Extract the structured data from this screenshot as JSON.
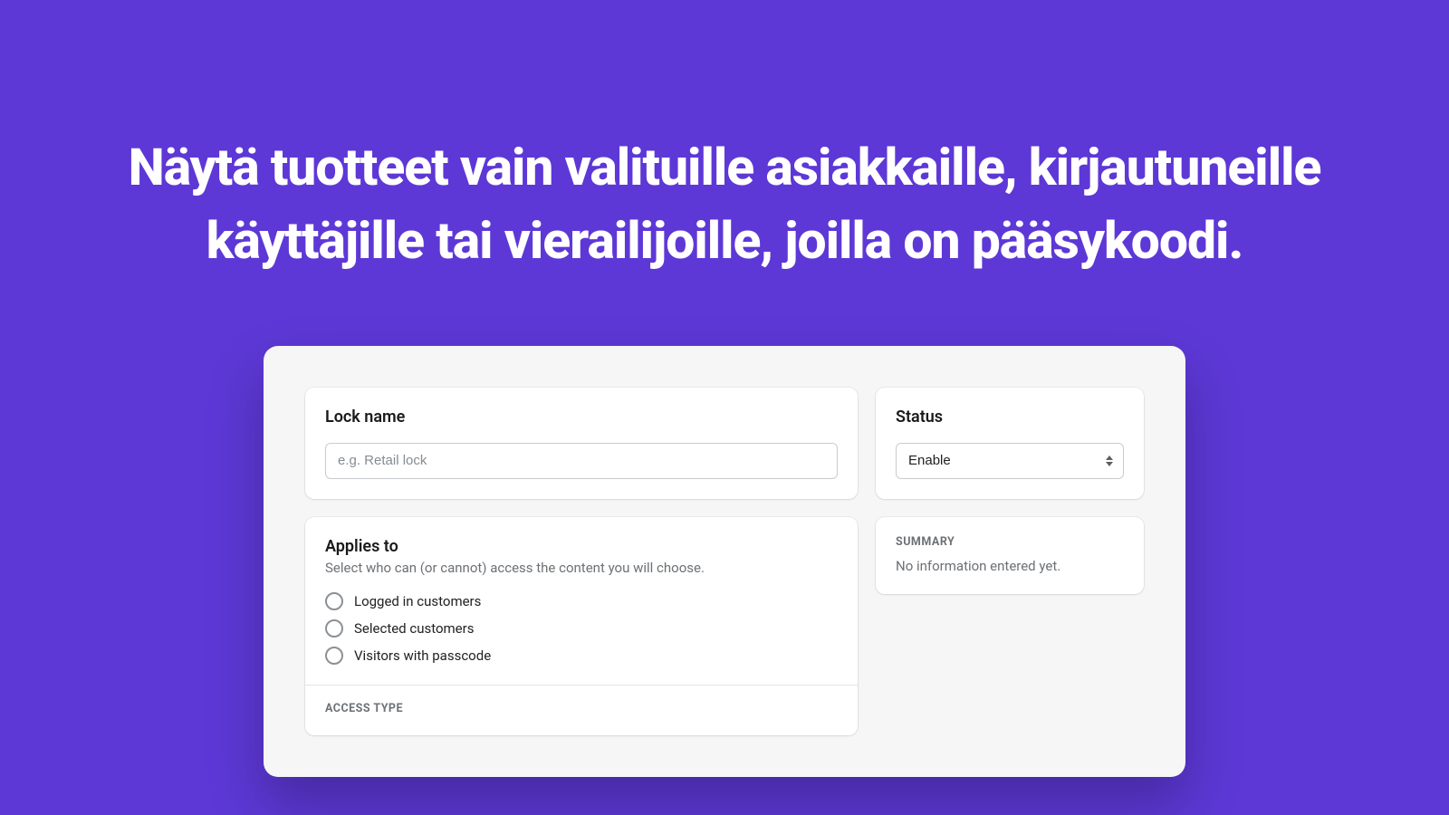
{
  "hero": {
    "headline": "Näytä tuotteet vain valituille asiakkaille, kirjautuneille käyttäjille tai vierailijoille, joilla on pääsykoodi."
  },
  "lock_name": {
    "title": "Lock name",
    "placeholder": "e.g. Retail lock",
    "value": ""
  },
  "applies_to": {
    "title": "Applies to",
    "description": "Select who can (or cannot) access the content you will choose.",
    "options": [
      "Logged in customers",
      "Selected customers",
      "Visitors with passcode"
    ]
  },
  "access_type": {
    "heading": "ACCESS TYPE"
  },
  "status": {
    "title": "Status",
    "selected": "Enable"
  },
  "summary": {
    "heading": "SUMMARY",
    "text": "No information entered yet."
  }
}
